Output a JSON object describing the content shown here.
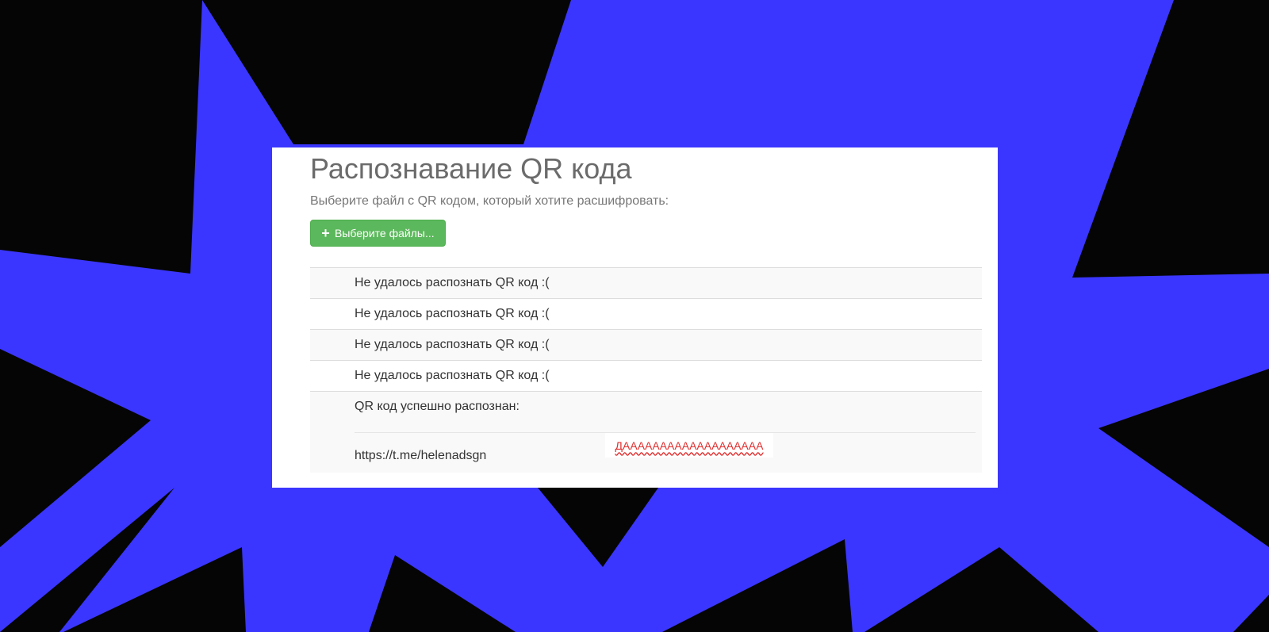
{
  "page": {
    "title": "Распознавание QR кода",
    "subtitle": "Выберите файл с QR кодом, который хотите расшифровать:",
    "upload_button": {
      "icon": "plus-icon",
      "label": "Выберите файлы..."
    }
  },
  "results": {
    "failed": [
      "Не удалось распознать QR код :(",
      "Не удалось распознать QR код :(",
      "Не удалось распознать QR код :(",
      "Не удалось распознать QR код :("
    ],
    "success": {
      "label": "QR код успешно распознан:",
      "value": "https://t.me/helenadsgn"
    }
  },
  "annotation": {
    "text": "ДААААААААААААААААААА"
  },
  "colors": {
    "background": "#050505",
    "shapes": "#3b36ff",
    "card": "#ffffff",
    "button": "#5cb85c",
    "annotation_text": "#e03030"
  }
}
